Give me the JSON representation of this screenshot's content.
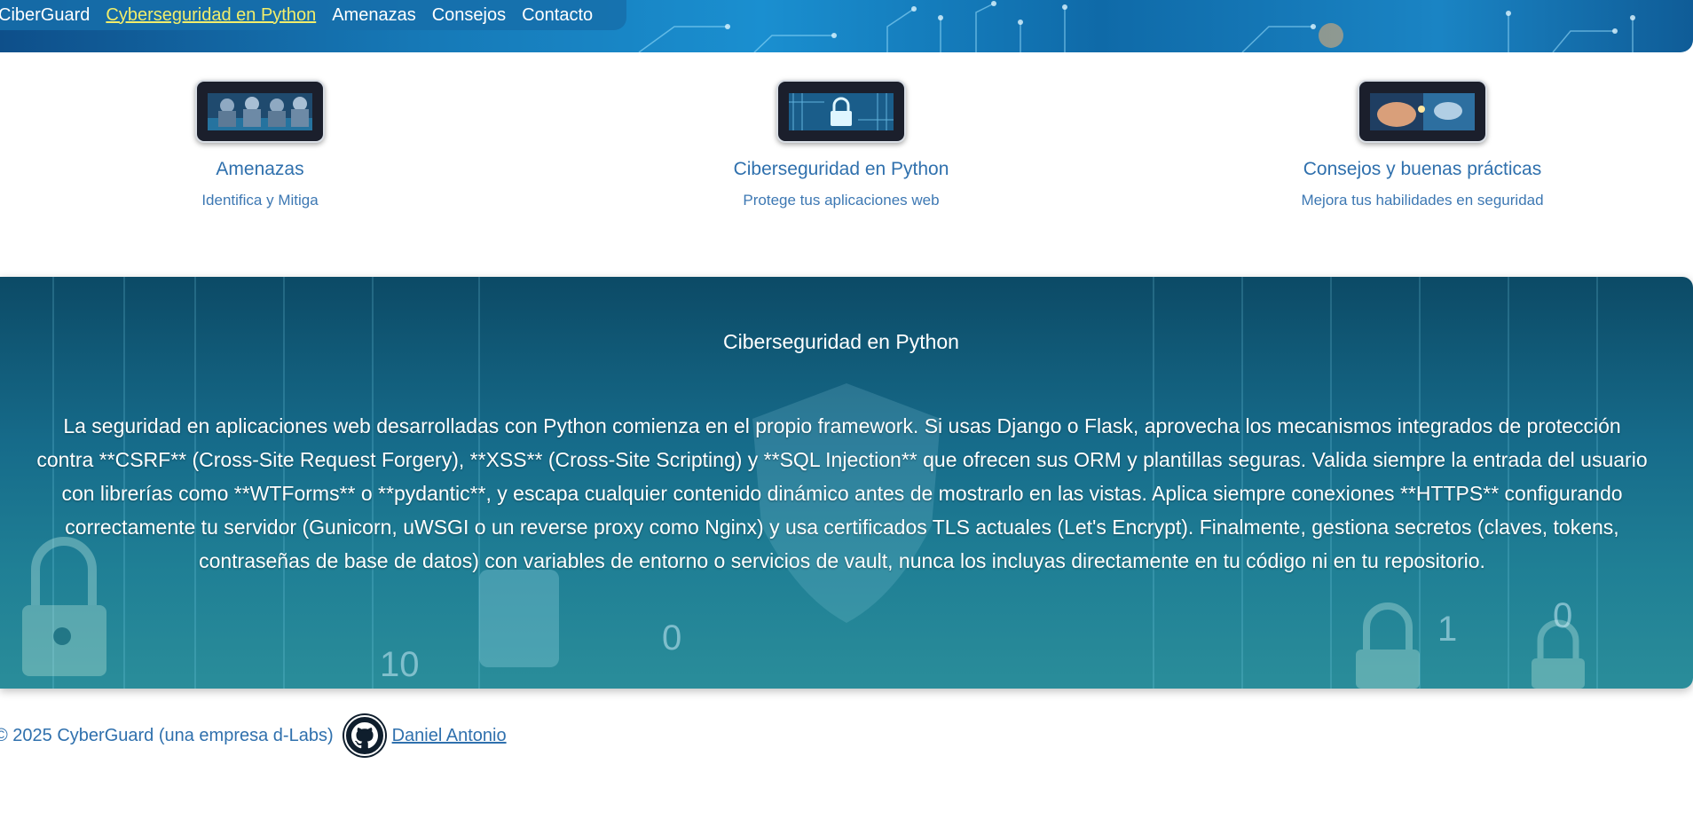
{
  "nav": {
    "brand": "CiberGuard",
    "items": [
      {
        "label": "Cyberseguridad en Python",
        "active": true
      },
      {
        "label": "Amenazas",
        "active": false
      },
      {
        "label": "Consejos",
        "active": false
      },
      {
        "label": "Contacto",
        "active": false
      }
    ]
  },
  "cards": [
    {
      "title": "Amenazas",
      "subtitle": "Identifica y Mitiga",
      "icon": "hackers-thumbnail"
    },
    {
      "title": "Ciberseguridad en Python",
      "subtitle": "Protege tus aplicaciones web",
      "icon": "padlock-thumbnail"
    },
    {
      "title": "Consejos y buenas prácticas",
      "subtitle": "Mejora tus habilidades en seguridad",
      "icon": "hands-thumbnail"
    }
  ],
  "section": {
    "title": "Ciberseguridad en Python",
    "body": "La seguridad en aplicaciones web desarrolladas con Python comienza en el propio framework. Si usas Django o Flask, aprovecha los mecanismos integrados de protección contra **CSRF** (Cross-Site Request Forgery), **XSS** (Cross-Site Scripting) y **SQL Injection** que ofrecen sus ORM y plantillas seguras. Valida siempre la entrada del usuario con librerías como **WTForms** o **pydantic**, y escapa cualquier contenido dinámico antes de mostrarlo en las vistas. Aplica siempre conexiones **HTTPS** configurando correctamente tu servidor (Gunicorn, uWSGI o un reverse proxy como Nginx) y usa certificados TLS actuales (Let's Encrypt). Finalmente, gestiona secretos (claves, tokens, contraseñas de base de datos) con variables de entorno o servicios de vault, nunca los incluyas directamente en tu código ni en tu repositorio."
  },
  "footer": {
    "copyright": "© 2025 CyberGuard (una empresa d-Labs)",
    "author": "Daniel Antonio",
    "icon": "github-icon"
  },
  "colors": {
    "link": "#2f70ad",
    "nav_active": "#f2ee6b",
    "header_blue": "#1679b7",
    "section_teal": "#166b8a"
  }
}
